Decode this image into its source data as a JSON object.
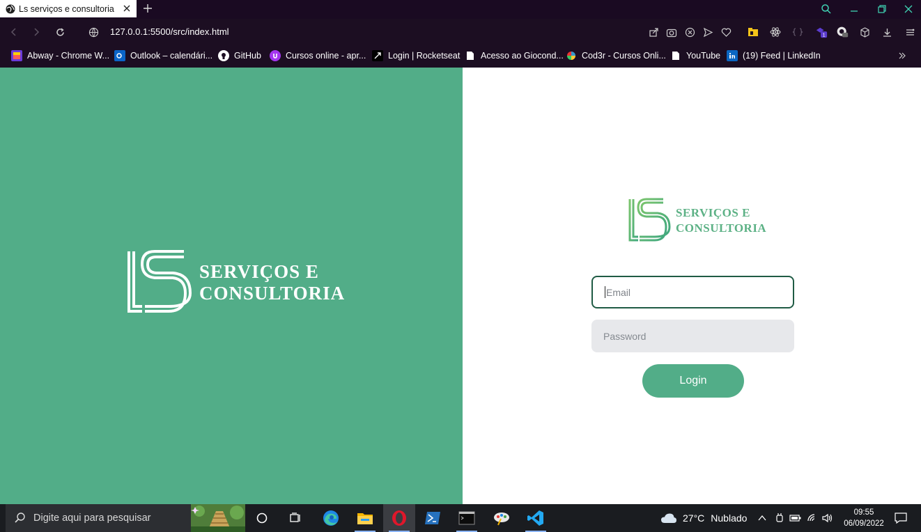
{
  "browser": {
    "tab_title": "Ls serviços e consultoria",
    "url": "127.0.0.1:5500/src/index.html"
  },
  "bookmarks": [
    {
      "label": "Abway - Chrome W...",
      "icon": "abway-icon"
    },
    {
      "label": "Outlook – calendári...",
      "icon": "outlook-icon"
    },
    {
      "label": "GitHub",
      "icon": "github-icon"
    },
    {
      "label": "Cursos online - apr...",
      "icon": "udemy-icon"
    },
    {
      "label": "Login | Rocketseat",
      "icon": "rocketseat-icon"
    },
    {
      "label": "Acesso ao Giocond...",
      "icon": "page-icon"
    },
    {
      "label": "Cod3r - Cursos Onli...",
      "icon": "cod3r-icon"
    },
    {
      "label": "YouTube",
      "icon": "page-icon"
    },
    {
      "label": "(19) Feed | LinkedIn",
      "icon": "linkedin-icon"
    }
  ],
  "page": {
    "brand_line1": "SERVIÇOS E",
    "brand_line2": "CONSULTORIA",
    "email_placeholder": "Email",
    "password_placeholder": "Password",
    "login_label": "Login",
    "colors": {
      "brand_green": "#52ad88",
      "logo_green": "#5cb185",
      "email_border": "#1f5b44"
    }
  },
  "taskbar": {
    "search_placeholder": "Digite aqui para pesquisar",
    "weather_temp": "27°C",
    "weather_text": "Nublado",
    "time": "09:55",
    "date": "06/09/2022"
  }
}
